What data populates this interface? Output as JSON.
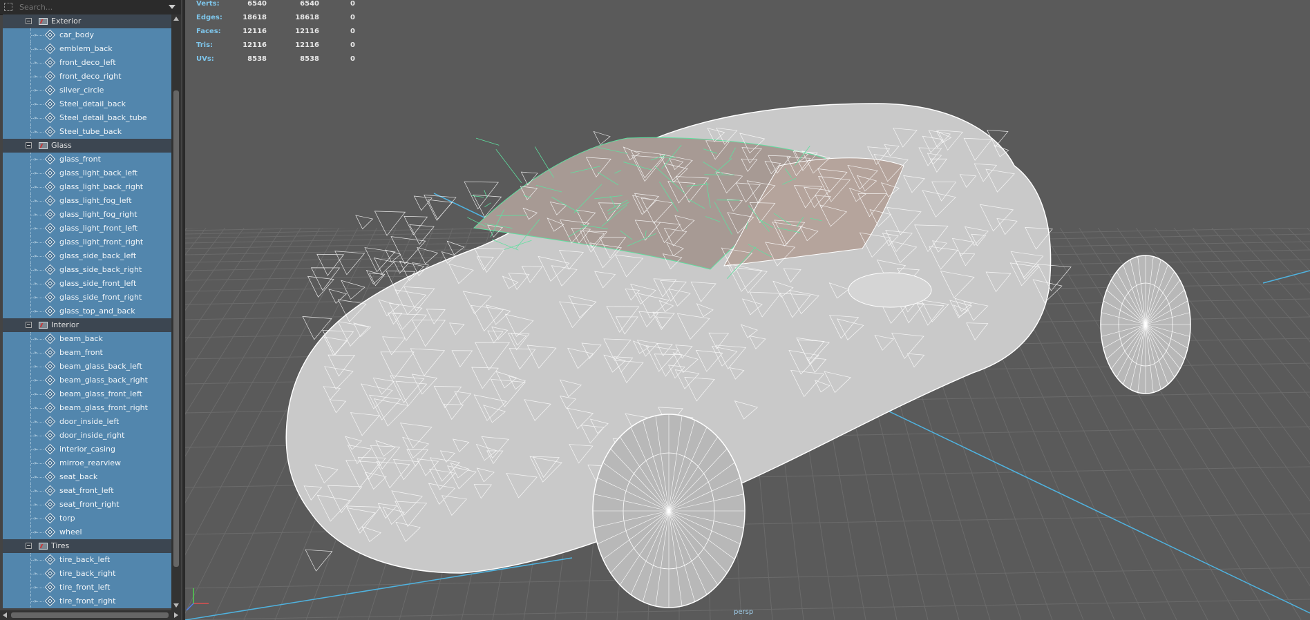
{
  "outliner": {
    "search_placeholder": "Search...",
    "groups": [
      {
        "name": "Exterior",
        "items": [
          "car_body",
          "emblem_back",
          "front_deco_left",
          "front_deco_right",
          "silver_circle",
          "Steel_detail_back",
          "Steel_detail_back_tube",
          "Steel_tube_back"
        ]
      },
      {
        "name": "Glass",
        "items": [
          "glass_front",
          "glass_light_back_left",
          "glass_light_back_right",
          "glass_light_fog_left",
          "glass_light_fog_right",
          "glass_light_front_left",
          "glass_light_front_right",
          "glass_side_back_left",
          "glass_side_back_right",
          "glass_side_front_left",
          "glass_side_front_right",
          "glass_top_and_back"
        ]
      },
      {
        "name": "Interior",
        "items": [
          "beam_back",
          "beam_front",
          "beam_glass_back_left",
          "beam_glass_back_right",
          "beam_glass_front_left",
          "beam_glass_front_right",
          "door_inside_left",
          "door_inside_right",
          "interior_casing",
          "mirroe_rearview",
          "seat_back",
          "seat_front_left",
          "seat_front_right",
          "torp",
          "wheel"
        ]
      },
      {
        "name": "Tires",
        "items": [
          "tire_back_left",
          "tire_back_right",
          "tire_front_left",
          "tire_front_right"
        ]
      }
    ]
  },
  "hud": {
    "rows": [
      {
        "label": "Verts:",
        "a": "6540",
        "b": "6540",
        "c": "0"
      },
      {
        "label": "Edges:",
        "a": "18618",
        "b": "18618",
        "c": "0"
      },
      {
        "label": "Faces:",
        "a": "12116",
        "b": "12116",
        "c": "0"
      },
      {
        "label": "Tris:",
        "a": "12116",
        "b": "12116",
        "c": "0"
      },
      {
        "label": "UVs:",
        "a": "8538",
        "b": "8538",
        "c": "0"
      }
    ]
  },
  "viewport": {
    "camera_label": "persp"
  },
  "colors": {
    "selection": "#5286ad",
    "hud_label": "#7ec5ea",
    "grid_axis": "#4fb3e0",
    "glass_wire": "#5fe0a0"
  }
}
